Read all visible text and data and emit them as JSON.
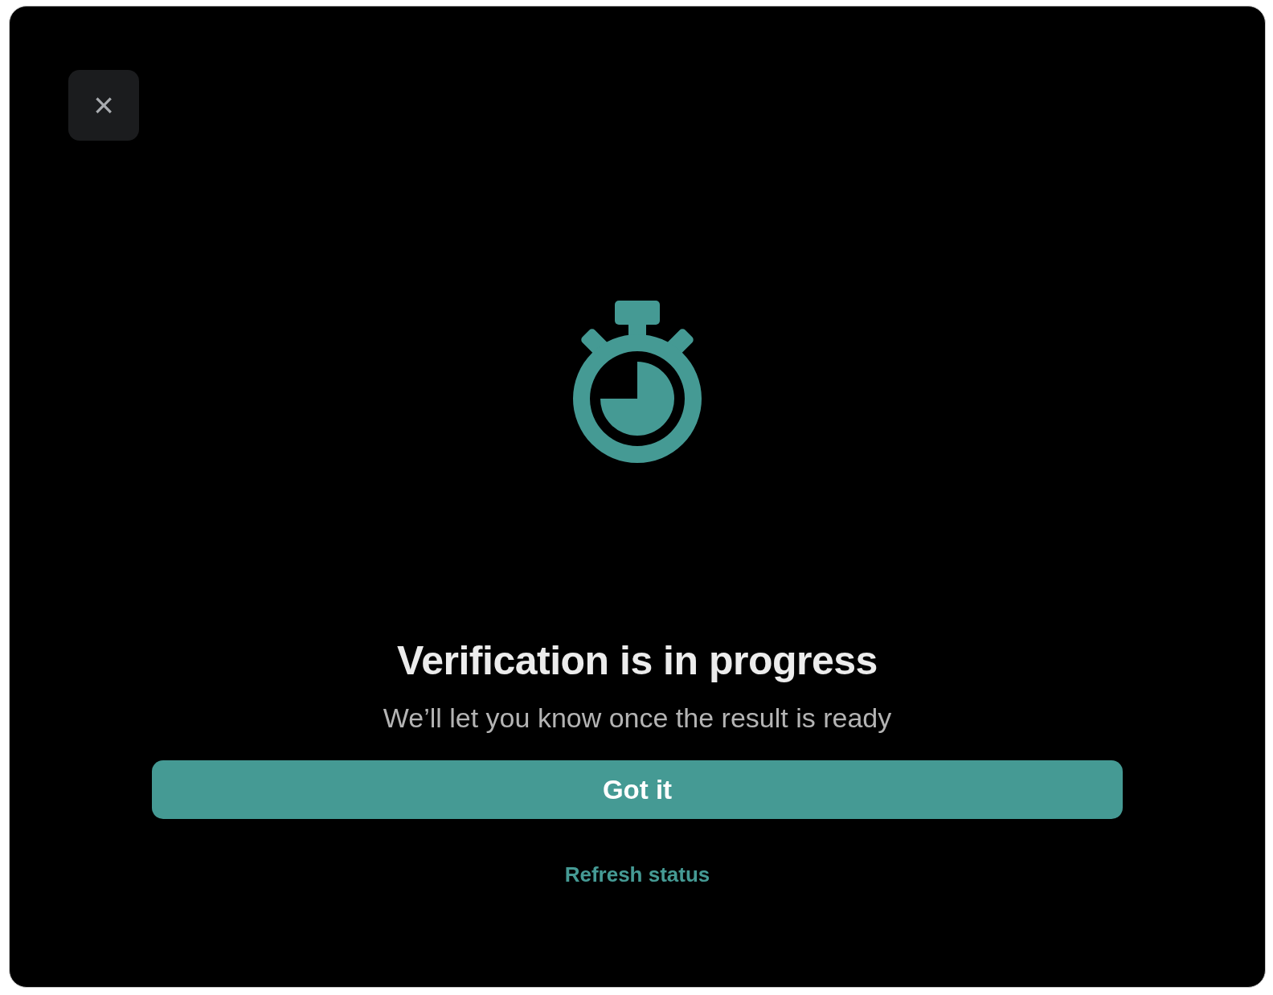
{
  "dialog": {
    "close_label": "×",
    "title": "Verification is in progress",
    "message": "We’ll let you know once the result is ready",
    "primary_button": "Got it",
    "link": "Refresh status"
  }
}
